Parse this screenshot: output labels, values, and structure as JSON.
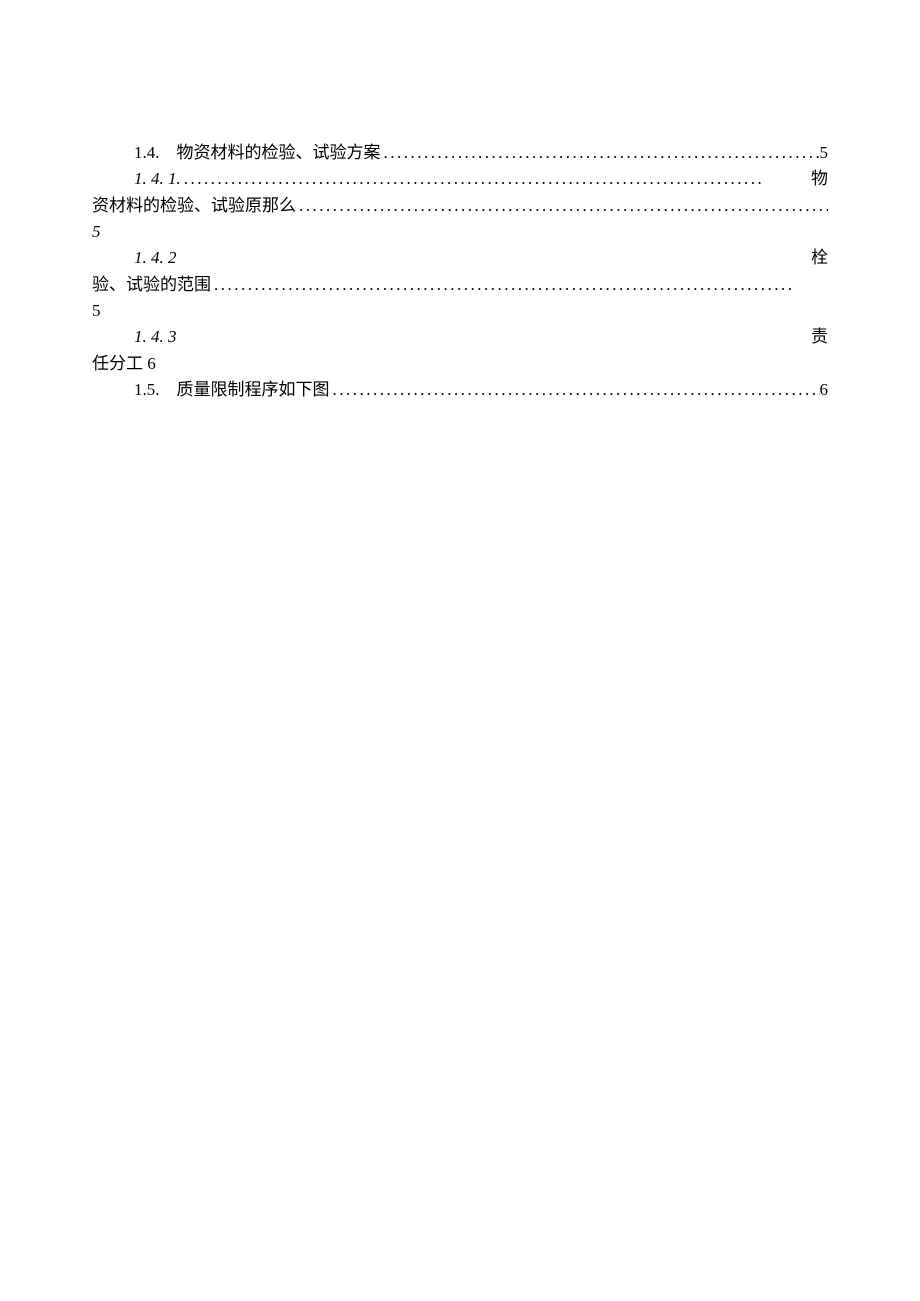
{
  "toc": {
    "entry_1_4": {
      "number": "1.4.",
      "title": "物资材料的检验、试验方案",
      "page": "5"
    },
    "entry_1_4_1": {
      "number": "1. 4. 1.",
      "suffix": "物",
      "continuation": "资材料的检验、试验原那么",
      "page": "5"
    },
    "entry_1_4_2": {
      "number": "1. 4. 2",
      "suffix": "栓",
      "continuation": "验、试验的范围",
      "page": "5"
    },
    "entry_1_4_3": {
      "number": "1. 4. 3",
      "suffix": "责",
      "continuation_full": "任分工 6"
    },
    "entry_1_5": {
      "number": "1.5.",
      "title": "质量限制程序如下图",
      "page": "6"
    }
  }
}
